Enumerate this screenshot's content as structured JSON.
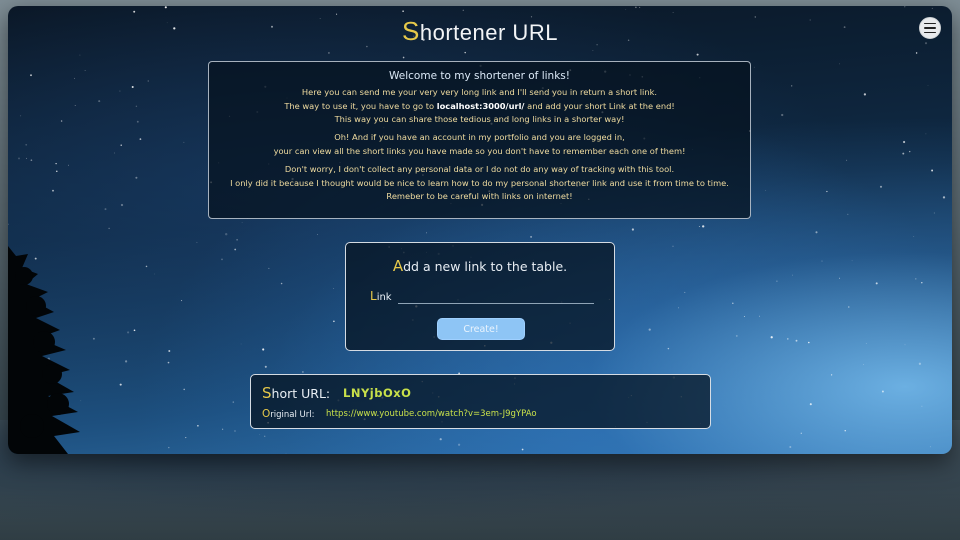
{
  "app": {
    "title_first": "S",
    "title_rest": "hortener URL"
  },
  "welcome": {
    "heading": "Welcome to my shortener of links!",
    "line1": "Here you can send me your very very long link and I'll send you in return a short link.",
    "line2_pre": "The way to use it, you have to go to ",
    "line2_bold": "localhost:3000/url/",
    "line2_post": " and add your short Link at the end!",
    "line3": "This way you can share those tedious and long links in a shorter way!",
    "line4": "Oh! And if you have an account in my portfolio and you are logged in,",
    "line5": "your can view all the short links you have made so you don't have to remember each one of them!",
    "line6": "Don't worry, I don't collect any personal data or I do not do any way of tracking with this tool.",
    "line7": "I only did it because I thought would be nice to learn how to do my personal shortener link and use it from time to time.",
    "line8": "Remeber to be careful with links on internet!"
  },
  "add_form": {
    "title_first": "A",
    "title_rest": "dd a new link to the table.",
    "link_label_first": "L",
    "link_label_rest": "ink",
    "link_value": "",
    "create_label": "Create!"
  },
  "result": {
    "short_label_first": "S",
    "short_label_rest": "hort URL:",
    "short_value": "LNYjbOxO",
    "orig_label_first": "O",
    "orig_label_rest": "riginal Url:",
    "orig_value": "https://www.youtube.com/watch?v=3em-J9gYPAo"
  },
  "icons": {
    "menu": "hamburger-menu-icon"
  },
  "colors": {
    "accent_yellow": "#e6c94a",
    "link_green": "#c8e04a",
    "button_blue": "#8ec5f5"
  }
}
